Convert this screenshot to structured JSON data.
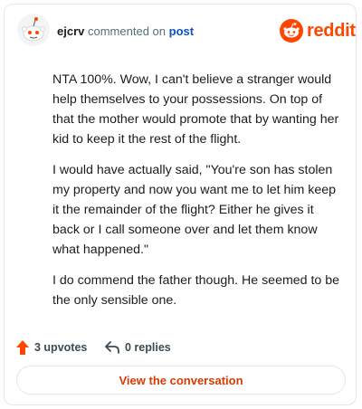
{
  "header": {
    "username": "ejcrv",
    "commented_on": "commented on",
    "post_link": "post",
    "brand": "reddit"
  },
  "comment": {
    "paragraphs": [
      "NTA 100%. Wow, I can't believe a stranger would help themselves to your possessions. On top of that the mother would promote that by wanting her kid to keep it the rest of the flight.",
      "I would have actually said, \"You're son has stolen my property and now you want me to let him keep it the remainder of the flight? Either he gives it back or I call someone over and let them know what happened.\"",
      "I do commend the father though. He seemed to be the only sensible one."
    ]
  },
  "actions": {
    "upvotes": "3 upvotes",
    "replies": "0 replies"
  },
  "cta": {
    "label": "View the conversation"
  },
  "colors": {
    "brand": "#ff4500",
    "link": "#0b53c9",
    "cta": "#d93a00"
  }
}
